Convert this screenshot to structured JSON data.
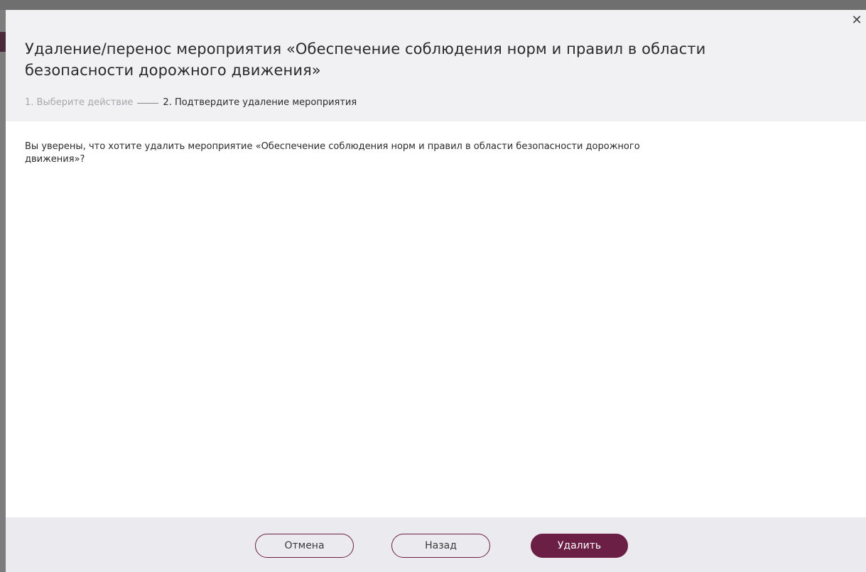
{
  "modal": {
    "title": "Удаление/перенос мероприятия «Обеспечение соблюдения норм и правил в области безопасности дорожного движения»",
    "close_icon": "close-icon",
    "steps": {
      "step1": "1. Выберите действие",
      "step2": "2. Подтвердите удаление мероприятия"
    },
    "body_text": "Вы уверены, что хотите удалить мероприятие «Обеспечение соблюдения норм и правил в области безопасности дорожного движения»?",
    "footer": {
      "cancel_label": "Отмена",
      "back_label": "Назад",
      "delete_label": "Удалить"
    }
  },
  "colors": {
    "accent": "#6b1f45",
    "header_bg": "#f1f1f3",
    "footer_bg": "#ebebef",
    "inactive_step": "#a7a7ab"
  }
}
